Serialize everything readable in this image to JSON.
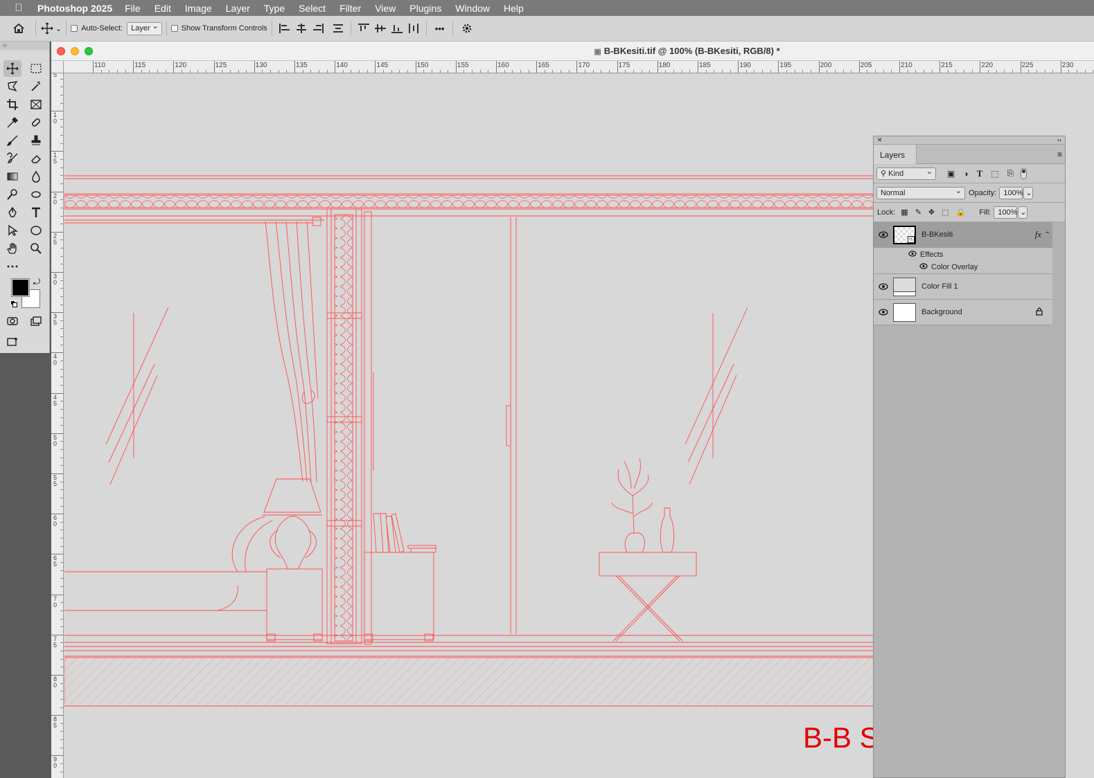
{
  "menubar": {
    "app_name": "Photoshop 2025",
    "items": [
      "File",
      "Edit",
      "Image",
      "Layer",
      "Type",
      "Select",
      "Filter",
      "View",
      "Plugins",
      "Window",
      "Help"
    ]
  },
  "options_bar": {
    "auto_select_label": "Auto-Select:",
    "auto_select_value": "Layer",
    "show_transform_label": "Show Transform Controls",
    "more_label": "•••"
  },
  "document": {
    "title": "B-BKesiti.tif @ 100% (B-BKesiti, RGB/8) *",
    "drawing_title": "B-B S",
    "ruler_h": [
      "110",
      "115",
      "120",
      "125",
      "130",
      "135",
      "140",
      "145",
      "150",
      "155",
      "160",
      "165",
      "170",
      "175",
      "180",
      "185",
      "190",
      "195",
      "200",
      "205",
      "210",
      "215",
      "220",
      "225",
      "230"
    ],
    "ruler_v": [
      "5",
      "1\n0",
      "1\n5",
      "2\n0",
      "2\n5",
      "3\n0",
      "3\n5",
      "4\n0",
      "4\n5",
      "5\n0",
      "5\n5",
      "6\n0",
      "6\n5",
      "7\n0",
      "7\n5",
      "8\n0",
      "8\n5",
      "9\n0"
    ],
    "accent_color": "#ff4d4d"
  },
  "layers_panel": {
    "tab_label": "Layers",
    "filter_kind": "Kind",
    "blend_mode": "Normal",
    "opacity_label": "Opacity:",
    "opacity_value": "100%",
    "lock_label": "Lock:",
    "fill_label": "Fill:",
    "fill_value": "100%",
    "layers": [
      {
        "name": "B-BKesiti",
        "fx": "fx",
        "effects_label": "Effects",
        "effect": "Color Overlay"
      },
      {
        "name": "Color Fill 1"
      },
      {
        "name": "Background"
      }
    ]
  }
}
